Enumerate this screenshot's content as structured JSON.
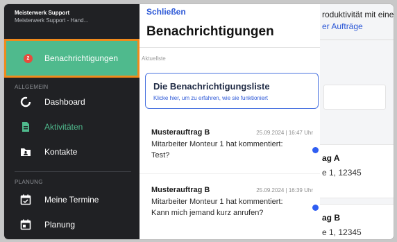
{
  "app": {
    "title": "Meisterwerk Support",
    "subtitle": "Meisterwerk Support - Hand..."
  },
  "sidebar": {
    "active_item": {
      "label": "Benachrichtigungen",
      "badge": "2",
      "icon": "bell-icon"
    },
    "sections": [
      {
        "label": "ALLGEMEIN",
        "items": [
          {
            "label": "Dashboard",
            "icon": "dashboard-ring-icon",
            "active": false
          },
          {
            "label": "Aktivitäten",
            "icon": "document-icon",
            "active": true
          },
          {
            "label": "Kontakte",
            "icon": "contacts-folder-icon",
            "active": false
          }
        ]
      },
      {
        "label": "PLANUNG",
        "items": [
          {
            "label": "Meine Termine",
            "icon": "calendar-check-icon",
            "active": false
          },
          {
            "label": "Planung",
            "icon": "calendar-icon",
            "active": false
          }
        ]
      }
    ]
  },
  "panel": {
    "close_label": "Schließen",
    "title": "Benachrichtigungen",
    "recent_label": "Aktuellste",
    "info": {
      "title": "Die Benachrichtigungsliste",
      "subtitle": "Klicke hier, um zu erfahren, wie sie funktioniert"
    },
    "notifications": [
      {
        "title": "Musterauftrag B",
        "time": "25.09.2024 | 16:47 Uhr",
        "body": "Mitarbeiter Monteur 1 hat kommentiert: Test?",
        "unread": true
      },
      {
        "title": "Musterauftrag B",
        "time": "25.09.2024 | 16:39 Uhr",
        "body": "Mitarbeiter Monteur 1 hat kommentiert: Kann mich jemand kurz anrufen?",
        "unread": true
      }
    ]
  },
  "background": {
    "top_text": "roduktivität mit eine",
    "link_text": "er Aufträge",
    "cards": [
      {
        "title": "ag A",
        "sub": "e 1, 12345"
      },
      {
        "title": "ag B",
        "sub": "e 1, 12345"
      }
    ]
  },
  "colors": {
    "sidebar_bg": "#202124",
    "active_green": "#4fba8d",
    "highlight_orange": "#f08a1c",
    "badge_red": "#e74c3c",
    "link_blue": "#2b57d6",
    "unread_dot": "#2f5ef2"
  }
}
